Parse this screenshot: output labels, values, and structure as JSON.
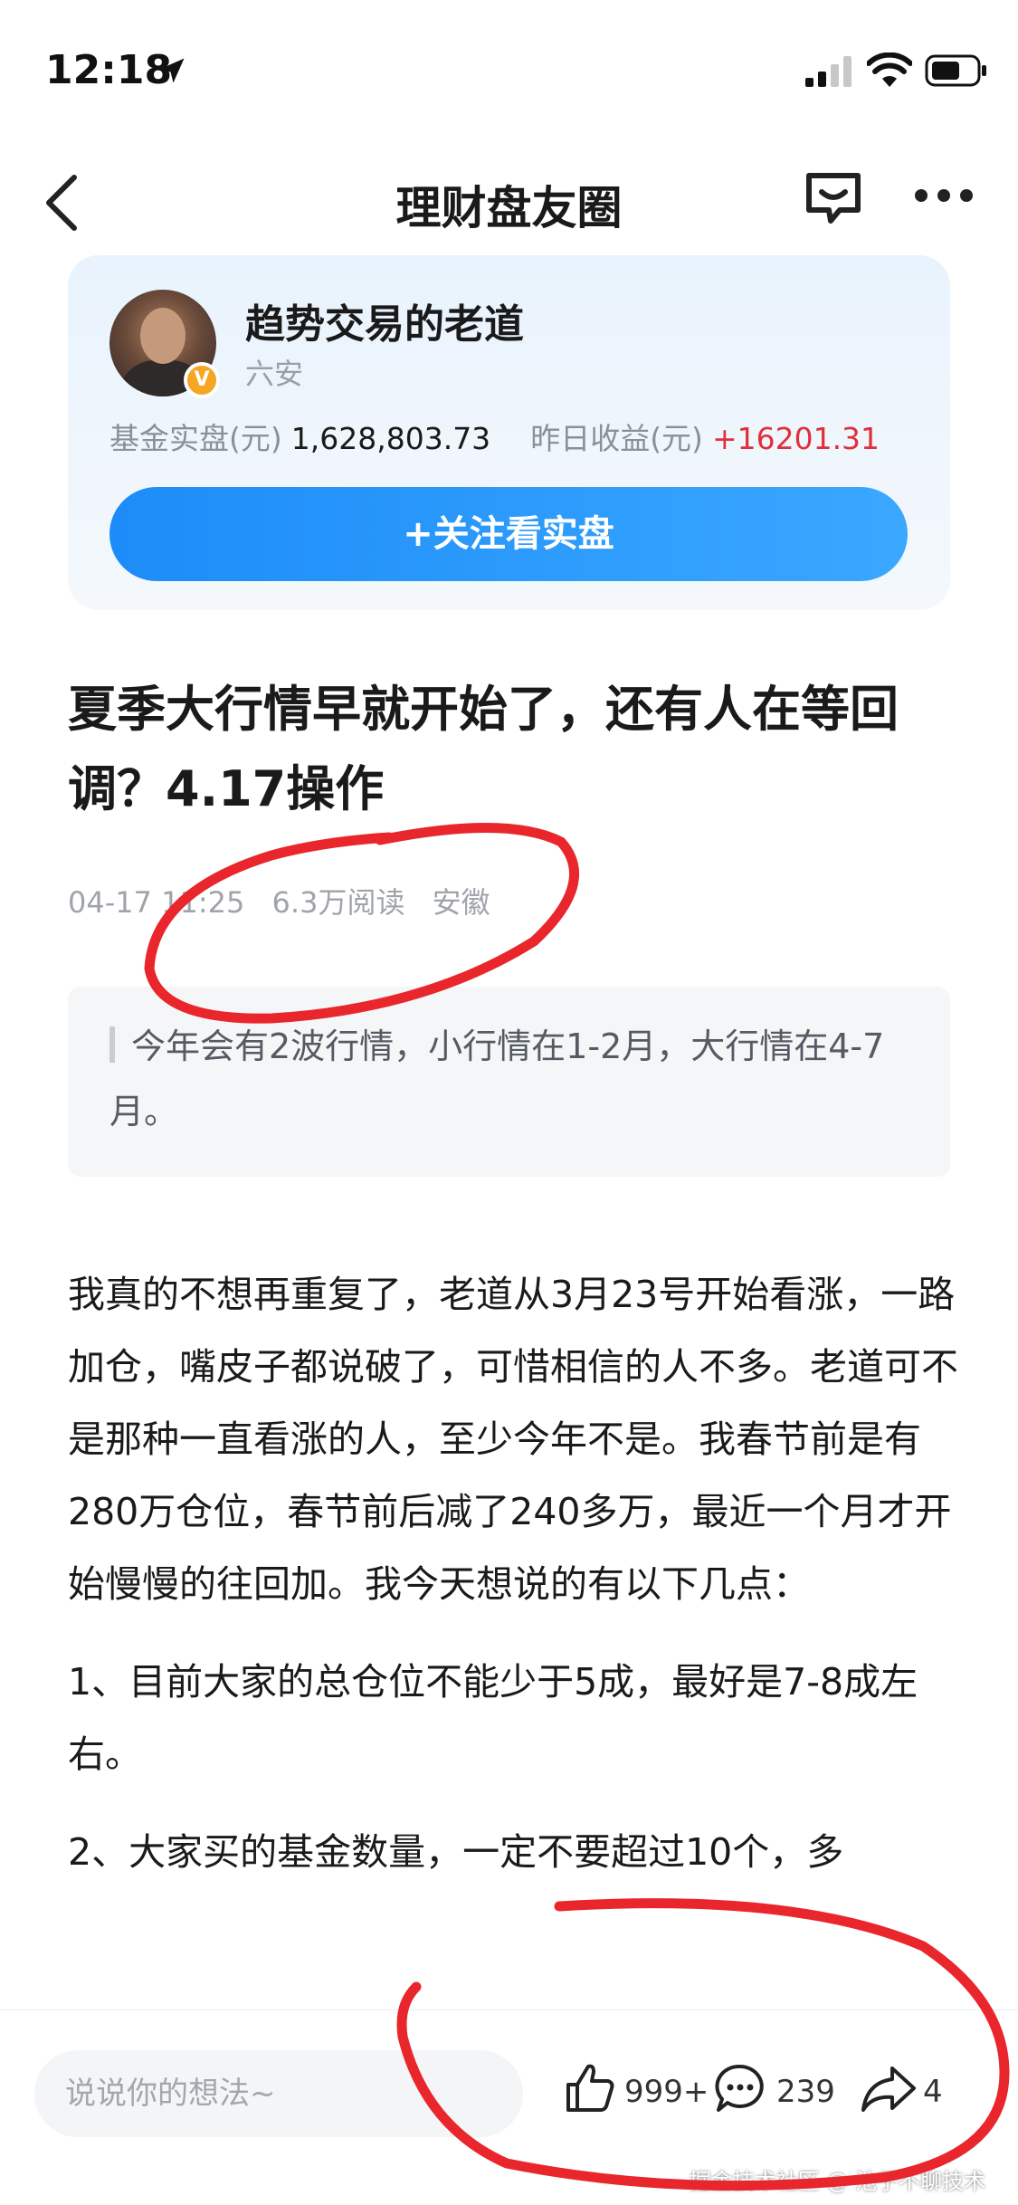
{
  "status_bar": {
    "time": "12:18"
  },
  "nav": {
    "title": "理财盘友圈"
  },
  "user_card": {
    "name": "趋势交易的老道",
    "location": "六安",
    "badge": "V",
    "fund_label": "基金实盘(元)",
    "fund_value": "1,628,803.73",
    "yesterday_label": "昨日收益(元)",
    "yesterday_value": "+16201.31",
    "follow_label": "+关注看实盘"
  },
  "article": {
    "title": "夏季大行情早就开始了，还有人在等回调？4.17操作",
    "meta": {
      "date": "04-17 11:25",
      "reads": "6.3万阅读",
      "location": "安徽"
    },
    "quote": "今年会有2波行情，小行情在1-2月，大行情在4-7月。",
    "paragraphs": [
      "我真的不想再重复了，老道从3月23号开始看涨，一路加仓，嘴皮子都说破了，可惜相信的人不多。老道可不是那种一直看涨的人，至少今年不是。我春节前是有280万仓位，春节前后减了240多万，最近一个月才开始慢慢的往回加。我今天想说的有以下几点：",
      "1、目前大家的总仓位不能少于5成，最好是7-8成左右。",
      "2、大家买的基金数量，一定不要超过10个，多"
    ]
  },
  "bottom_bar": {
    "comment_placeholder": "说说你的想法~",
    "likes": "999+",
    "comments": "239",
    "shares": "4"
  },
  "watermark": "掘金技术社区 @ 池子不聊技术",
  "colors": {
    "accent": "#1d8cf8",
    "profit": "#e0303c",
    "annotation": "#e8262c"
  },
  "icons": [
    "location-arrow-icon",
    "signal-icon",
    "wifi-icon",
    "battery-icon",
    "back-icon",
    "message-icon",
    "more-icon",
    "like-icon",
    "comment-icon",
    "share-icon"
  ]
}
